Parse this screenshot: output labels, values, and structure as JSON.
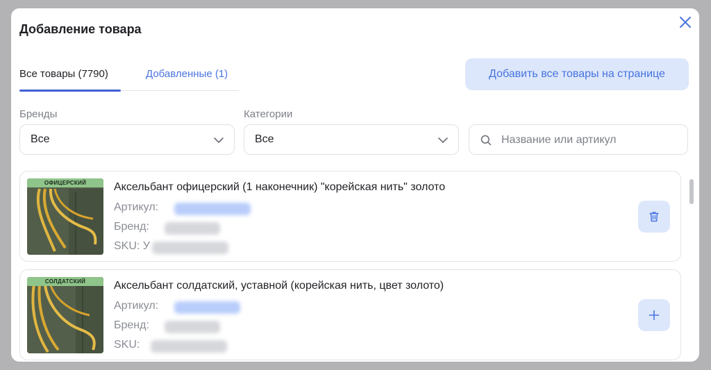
{
  "modal": {
    "title": "Добавление товара",
    "close_icon": "close-icon"
  },
  "tabs": [
    {
      "label": "Все товары (7790)",
      "active": true
    },
    {
      "label": "Добавленные (1)",
      "active": false
    }
  ],
  "add_all_button": "Добавить все товары на странице",
  "filters": {
    "brands": {
      "label": "Бренды",
      "value": "Все"
    },
    "categories": {
      "label": "Категории",
      "value": "Все"
    },
    "search": {
      "placeholder": "Название или артикул",
      "value": ""
    }
  },
  "products": [
    {
      "name": "Аксельбант офицерский (1 наконечник) \"корейская нить\" золото",
      "thumb_label": "ОФИЦЕРСКИЙ",
      "article_label": "Артикул:",
      "brand_label": "Бренд:",
      "sku_label": "SKU:",
      "sku_visible": "У",
      "action_icon": "trash-icon"
    },
    {
      "name": "Аксельбант солдатский, уставной (корейская нить, цвет золото)",
      "thumb_label": "СОЛДАТСКИЙ",
      "article_label": "Артикул:",
      "brand_label": "Бренд:",
      "sku_label": "SKU:",
      "sku_visible": "",
      "action_icon": "plus-icon"
    }
  ],
  "colors": {
    "accent": "#4a74e0",
    "accent_bg": "#dde7fb",
    "text": "#1f2024",
    "muted": "#7d8088"
  }
}
